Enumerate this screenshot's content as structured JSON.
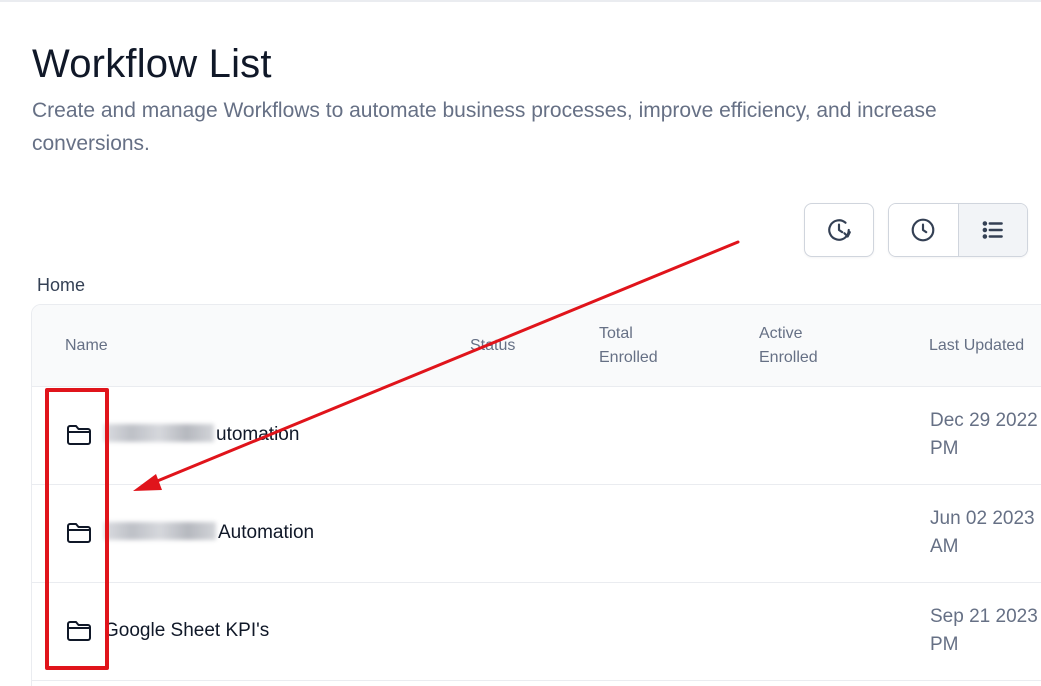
{
  "header": {
    "title": "Workflow List",
    "subtitle": "Create and manage Workflows to automate business processes, improve efficiency, and increase conversions."
  },
  "toolbar": {
    "history_icon": "history-icon",
    "clock_icon": "clock-icon",
    "list_icon": "list-icon",
    "active_view": "list"
  },
  "breadcrumb": {
    "home": "Home"
  },
  "table": {
    "columns": {
      "name": "Name",
      "status": "Status",
      "total_line1": "Total",
      "total_line2": "Enrolled",
      "active_line1": "Active",
      "active_line2": "Enrolled",
      "last_updated": "Last Updated"
    },
    "rows": [
      {
        "icon": "folder-icon",
        "name": "utomation",
        "date_line1": "Dec 29 2022",
        "date_line2": "PM"
      },
      {
        "icon": "folder-icon",
        "name": "Automation",
        "date_line1": "Jun 02 2023",
        "date_line2": "AM"
      },
      {
        "icon": "folder-icon",
        "name": "Google Sheet KPI's",
        "date_line1": "Sep 21 2023",
        "date_line2": "PM"
      }
    ]
  },
  "annotation": {
    "color": "#e0141b"
  },
  "colors": {
    "text_primary": "#101828",
    "text_secondary": "#667085",
    "border": "#d0d5dd",
    "header_bg": "#f9fafb"
  }
}
